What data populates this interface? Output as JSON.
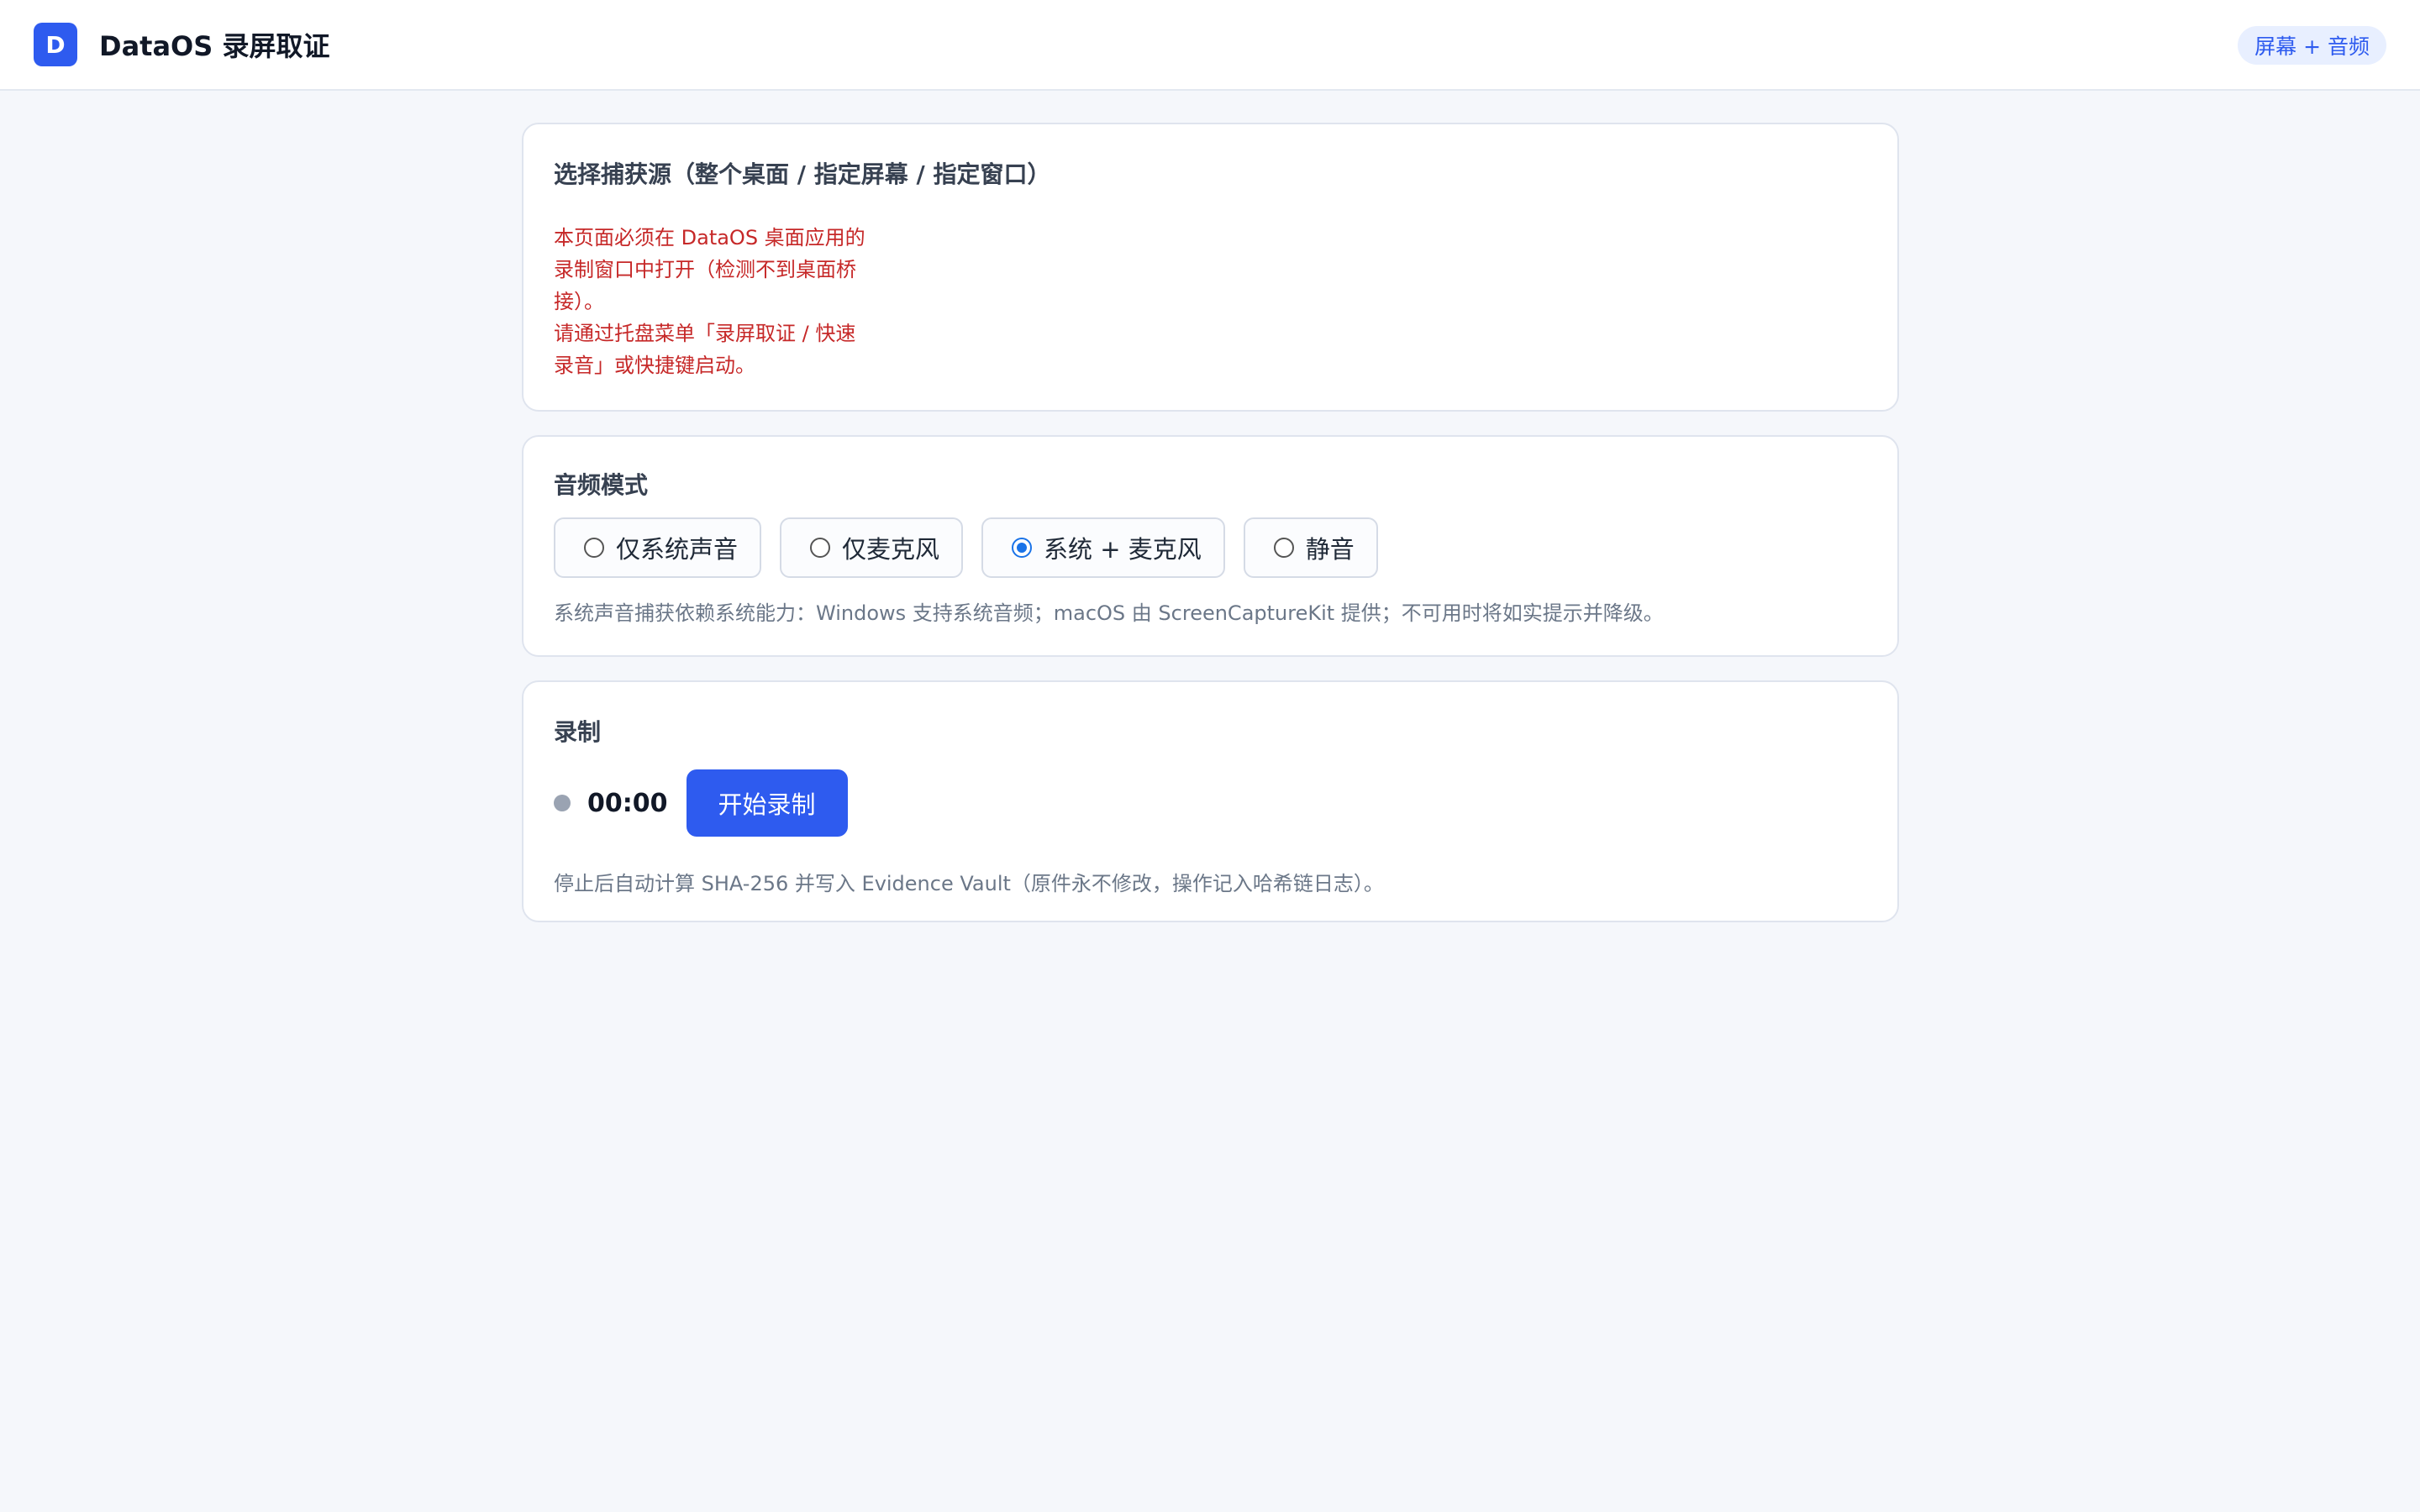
{
  "header": {
    "logo_letter": "D",
    "title": "DataOS 录屏取证",
    "mode_badge": "屏幕 + 音频"
  },
  "source": {
    "title": "选择捕获源（整个桌面 / 指定屏幕 / 指定窗口）",
    "warning_lines": [
      "本页面必须在 DataOS 桌面应用的",
      "录制窗口中打开（检测不到桌面桥",
      "接）。",
      "请通过托盘菜单「录屏取证 / 快速",
      "录音」或快捷键启动。"
    ]
  },
  "audio": {
    "title": "音频模式",
    "options": [
      {
        "label": "仅系统声音",
        "selected": false
      },
      {
        "label": "仅麦克风",
        "selected": false
      },
      {
        "label": "系统 + 麦克风",
        "selected": true
      },
      {
        "label": "静音",
        "selected": false
      }
    ],
    "hint": "系统声音捕获依赖系统能力：Windows 支持系统音频；macOS 由 ScreenCaptureKit 提供；不可用时将如实提示并降级。"
  },
  "recording": {
    "title": "录制",
    "timer": "00:00",
    "start_label": "开始录制",
    "hint": "停止后自动计算 SHA-256 并写入 Evidence Vault（原件永不修改，操作记入哈希链日志）。"
  },
  "colors": {
    "accent": "#2e5bef",
    "warning": "#c62828",
    "background": "#f5f7fb"
  }
}
